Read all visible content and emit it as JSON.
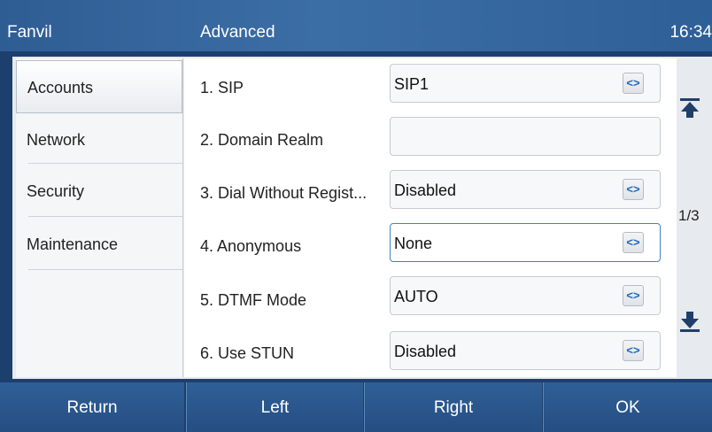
{
  "header": {
    "brand": "Fanvil",
    "title": "Advanced",
    "time": "16:34"
  },
  "sidebar": {
    "items": [
      {
        "label": "Accounts",
        "selected": true
      },
      {
        "label": "Network",
        "selected": false
      },
      {
        "label": "Security",
        "selected": false
      },
      {
        "label": "Maintenance",
        "selected": false
      }
    ]
  },
  "settings": {
    "rows": [
      {
        "label": "1. SIP",
        "value": "SIP1",
        "type": "select"
      },
      {
        "label": "2. Domain Realm",
        "value": "",
        "type": "text"
      },
      {
        "label": "3. Dial Without Regist...",
        "value": "Disabled",
        "type": "select"
      },
      {
        "label": "4. Anonymous",
        "value": "None",
        "type": "select",
        "focused": true
      },
      {
        "label": "5. DTMF Mode",
        "value": "AUTO",
        "type": "select"
      },
      {
        "label": "6. Use STUN",
        "value": "Disabled",
        "type": "select"
      }
    ],
    "select_glyph": "<>"
  },
  "pager": {
    "indicator": "1/3",
    "scroll_top_icon": "scroll-to-top-icon",
    "scroll_bottom_icon": "scroll-to-bottom-icon"
  },
  "softkeys": {
    "return": "Return",
    "left": "Left",
    "right": "Right",
    "ok": "OK"
  },
  "colors": {
    "bar_blue": "#2f5f97",
    "focus_blue": "#4a7fbf",
    "arrow_blue": "#1f66b8"
  }
}
